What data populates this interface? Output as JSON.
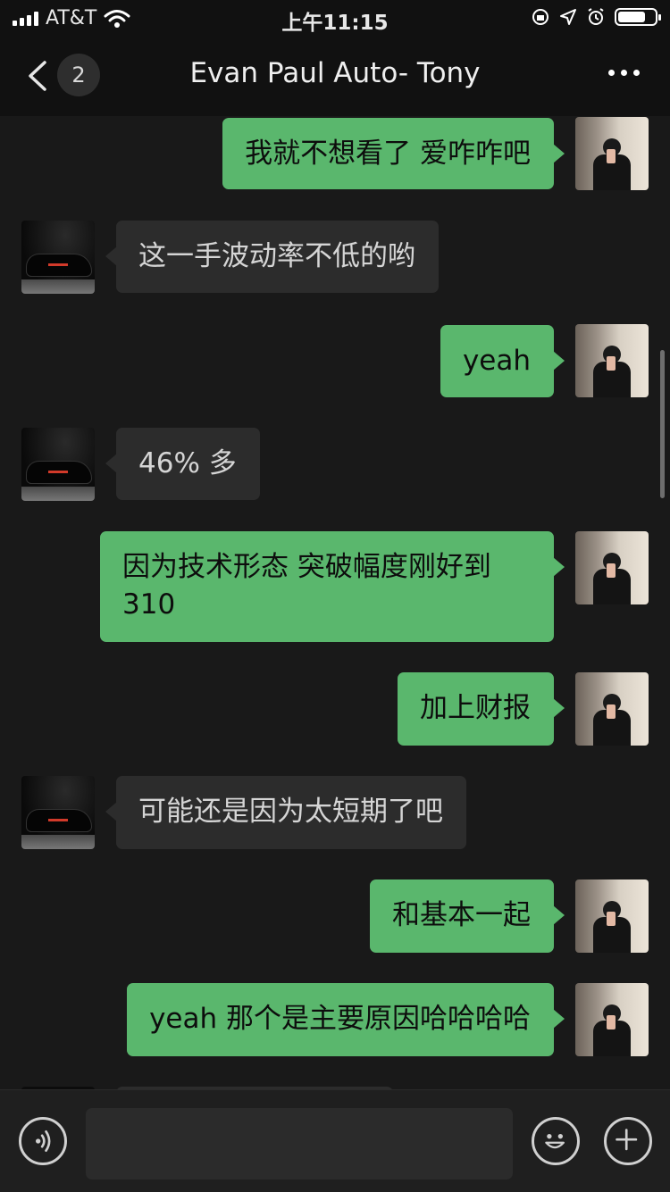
{
  "status_bar": {
    "carrier": "AT&T",
    "time": "上午11:15",
    "battery_level": 0.75
  },
  "header": {
    "back_badge": "2",
    "title": "Evan Paul Auto- Tony"
  },
  "messages": [
    {
      "from": "me",
      "text": "我就不想看了 爱咋咋吧"
    },
    {
      "from": "them",
      "text": "这一手波动率不低的哟"
    },
    {
      "from": "me",
      "text": "yeah"
    },
    {
      "from": "them",
      "text": "46% 多"
    },
    {
      "from": "me",
      "text": "因为技术形态 突破幅度刚好到310"
    },
    {
      "from": "me",
      "text": "加上财报"
    },
    {
      "from": "them",
      "text": "可能还是因为太短期了吧"
    },
    {
      "from": "me",
      "text": "和基本一起"
    },
    {
      "from": "me",
      "text": "yeah 那个是主要原因哈哈哈哈"
    }
  ],
  "input": {
    "value": ""
  },
  "icons": {
    "back": "chevron-left-icon",
    "more": "more-icon",
    "voice": "voice-icon",
    "emoji": "emoji-icon",
    "plus": "plus-icon"
  },
  "colors": {
    "bubble_me": "#5ab76d",
    "bubble_them": "#2c2c2c",
    "background": "#191919"
  }
}
